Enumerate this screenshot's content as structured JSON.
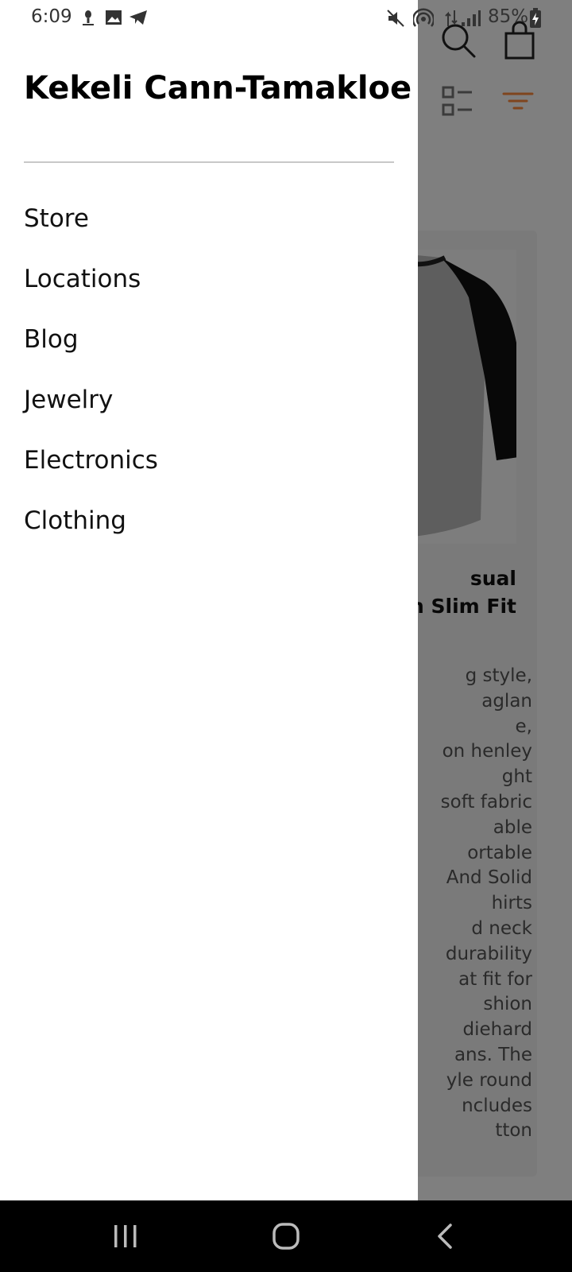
{
  "status_bar": {
    "time": "6:09",
    "battery_text": "85%",
    "icons": [
      "podcast-icon",
      "image-icon",
      "telegram-icon",
      "mute-icon",
      "hotspot-icon",
      "data-icon",
      "signal-icon",
      "battery-charging-icon"
    ]
  },
  "header": {
    "icons": [
      "search-icon",
      "shopping-bag-icon",
      "list-view-icon",
      "filter-icon"
    ],
    "accent_color": "#ff8a3d"
  },
  "product": {
    "title_visible": "sual\nn Slim Fit",
    "description_visible": "g style,\naglan\ne,\non henley\nght\nsoft fabric\nable\nortable\nAnd Solid\nhirts\nd neck\ndurability\nat fit for\nshion\ndiehard\nans. The\nyle round\nncludes\ntton"
  },
  "drawer": {
    "user_name": "Kekeli Cann-Tamakloe",
    "items": [
      {
        "label": "Store"
      },
      {
        "label": "Locations"
      },
      {
        "label": "Blog"
      },
      {
        "label": "Jewelry"
      },
      {
        "label": "Electronics"
      },
      {
        "label": "Clothing"
      }
    ]
  },
  "nav_bar": {
    "icons": [
      "recent-apps-icon",
      "home-icon",
      "back-icon"
    ]
  }
}
